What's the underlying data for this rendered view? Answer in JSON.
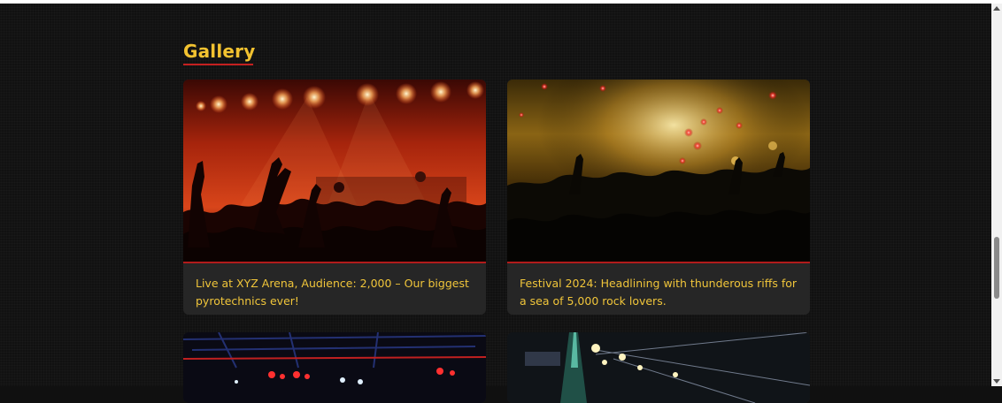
{
  "gallery": {
    "title": "Gallery",
    "items": [
      {
        "caption": "Live at XYZ Arena, Audience: 2,000 – Our biggest pyrotechnics ever!",
        "image": "concert-crowd-red-stage-photo"
      },
      {
        "caption": "Festival 2024: Headlining with thunderous riffs for a sea of 5,000 rock lovers.",
        "image": "festival-crowd-gold-lights-photo"
      },
      {
        "caption": "",
        "image": "stage-rig-red-lights-photo"
      },
      {
        "caption": "",
        "image": "stage-light-beams-photo"
      }
    ]
  },
  "colors": {
    "background": "#111111",
    "accent": "#f2c230",
    "underline": "#c42020",
    "card": "#262626"
  }
}
